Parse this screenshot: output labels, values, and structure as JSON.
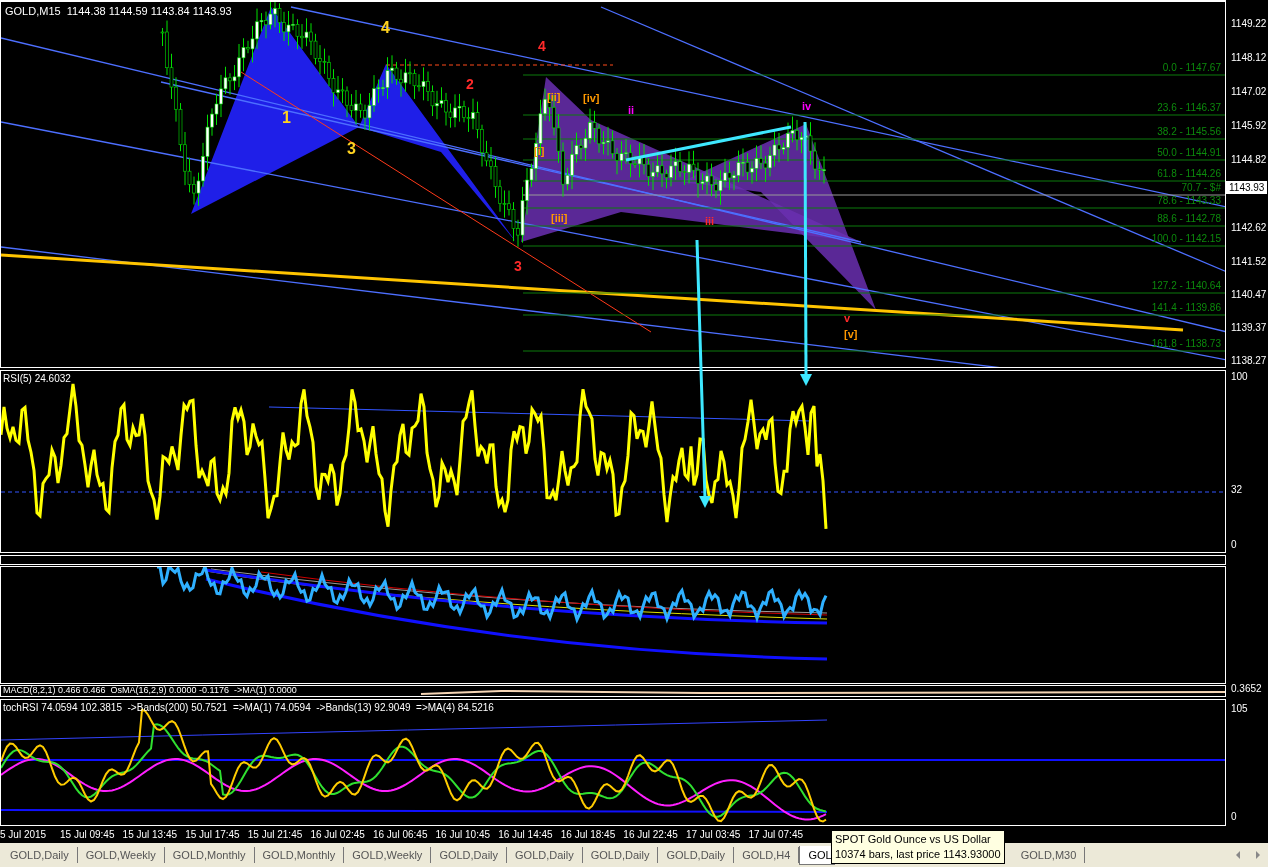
{
  "chart": {
    "header": "GOLD,M15  1144.38 1144.59 1143.84 1143.93",
    "price_axis": [
      "1149.22",
      "1148.12",
      "1147.02",
      "1145.92",
      "1144.82",
      "1142.62",
      "1141.52",
      "1140.47",
      "1139.37",
      "1138.27"
    ],
    "current_price": "1143.93",
    "wave_labels": [
      {
        "text": "4",
        "kind": "primary",
        "color": "#ffd21f"
      },
      {
        "text": "4",
        "kind": "intermediate",
        "color": "#ff2a2a"
      },
      {
        "text": "2",
        "kind": "intermediate",
        "color": "#ff2a2a"
      },
      {
        "text": "1",
        "kind": "primary",
        "color": "#ffd21f"
      },
      {
        "text": "3",
        "kind": "primary",
        "color": "#ffd21f"
      },
      {
        "text": "3",
        "kind": "intermediate",
        "color": "#ff2a2a"
      },
      {
        "text": "[ii]",
        "kind": "minor",
        "color": "#ff9900"
      },
      {
        "text": "[iv]",
        "kind": "minor",
        "color": "#ff9900"
      },
      {
        "text": "ii",
        "kind": "minor",
        "color": "#ff00ff"
      },
      {
        "text": "iv",
        "kind": "minor",
        "color": "#ff00ff"
      },
      {
        "text": "iii",
        "kind": "minor",
        "color": "#ff2a2a"
      },
      {
        "text": "[iii]",
        "kind": "minor",
        "color": "#ff9900"
      },
      {
        "text": "[i]",
        "kind": "minor",
        "color": "#ff9900"
      },
      {
        "text": "v",
        "kind": "minor",
        "color": "#ff2a2a"
      },
      {
        "text": "[v]",
        "kind": "minor",
        "color": "#ff9900"
      }
    ],
    "fib_levels": [
      "0.0 - 1147.67",
      "23.6  - 1146.37",
      "38.2 - 1145.56",
      "50.0 - 1144.91",
      "61.8 - 1144.26",
      "70.7 - $#",
      "78.6 - 1143.33",
      "88.6 - 1142.78",
      "100.0 - 1142.15",
      "127.2 - 1140.64",
      "141.4 - 1139.86",
      "161.8 - 1138.73"
    ]
  },
  "rsi": {
    "label": "RSI(5) 24.6032",
    "axis": [
      "100",
      "32",
      "0"
    ]
  },
  "macd": {
    "label": "MACD(8,2,1) 0.466 0.466  OsMA(16,2,9) 0.0000 -0.1176  ->MA(1) 0.0000",
    "axis": [
      "0.3652"
    ]
  },
  "stoch_rsi": {
    "label": "tochRSI 74.0594 102.3815  ->Bands(200) 50.7521  =>MA(1) 74.0594  ->Bands(13) 92.9049  =>MA(4) 84.5216",
    "axis": [
      "105",
      "0"
    ]
  },
  "time_axis": [
    "5 Jul 2015",
    "15 Jul 09:45",
    "15 Jul 13:45",
    "15 Jul 17:45",
    "15 Jul 21:45",
    "16 Jul 02:45",
    "16 Jul 06:45",
    "16 Jul 10:45",
    "16 Jul 14:45",
    "16 Jul 18:45",
    "16 Jul 22:45",
    "17 Jul 03:45",
    "17 Jul 07:45"
  ],
  "tabs": [
    {
      "label": "GOLD,Daily",
      "selected": false
    },
    {
      "label": "GOLD,Weekly",
      "selected": false
    },
    {
      "label": "GOLD,Monthly",
      "selected": false
    },
    {
      "label": "GOLD,Monthly",
      "selected": false
    },
    {
      "label": "GOLD,Weekly",
      "selected": false
    },
    {
      "label": "GOLD,Daily",
      "selected": false
    },
    {
      "label": "GOLD,Daily",
      "selected": false
    },
    {
      "label": "GOLD,Daily",
      "selected": false
    },
    {
      "label": "GOLD,Daily",
      "selected": false
    },
    {
      "label": "GOLD,H4",
      "selected": false
    },
    {
      "label": "GOL",
      "selected": true
    },
    {
      "label": "GOLD,M30",
      "selected": false
    }
  ],
  "tooltip": [
    "SPOT Gold Ounce vs US Dollar",
    "10374 bars, last price 1143.93000"
  ]
}
